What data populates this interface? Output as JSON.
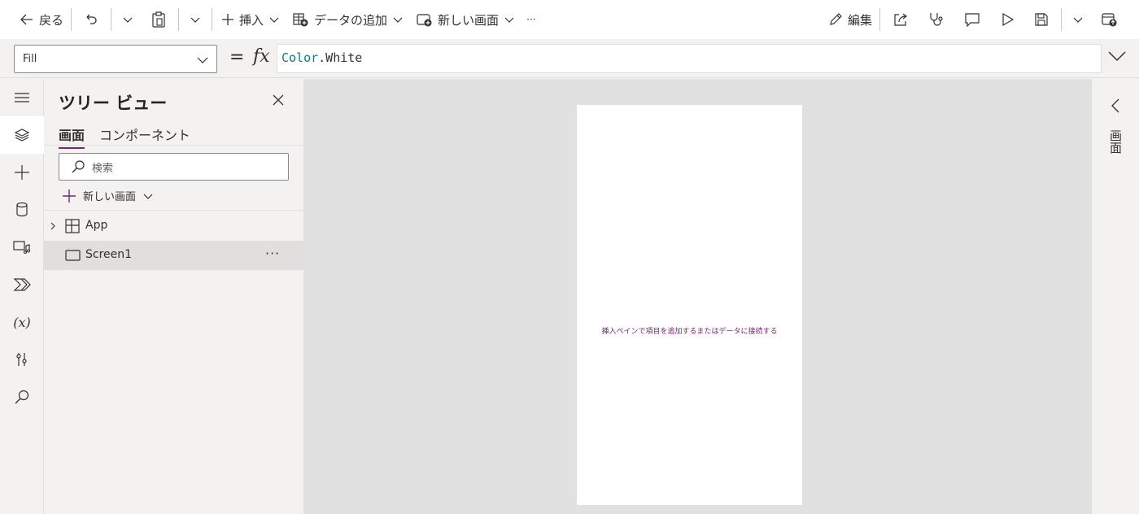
{
  "toolbar": {
    "back_label": "戻る",
    "insert_label": "挿入",
    "add_data_label": "データの追加",
    "new_screen_label": "新しい画面",
    "more_label": "···",
    "edit_label": "編集"
  },
  "formula_bar": {
    "property": "Fill",
    "equals": "=",
    "fx": "fx",
    "formula_object": "Color",
    "formula_rest": ".White"
  },
  "tree_view": {
    "title": "ツリー ビュー",
    "tabs": [
      {
        "label": "画面",
        "selected": true
      },
      {
        "label": "コンポーネント",
        "selected": false
      }
    ],
    "search_placeholder": "検索",
    "new_screen_label": "新しい画面",
    "nodes": [
      {
        "label": "App",
        "icon": "app-grid-icon"
      },
      {
        "label": "Screen1",
        "icon": "screen-icon",
        "selected": true,
        "more": "···"
      }
    ]
  },
  "left_rail": {
    "items": [
      "hamburger-icon",
      "layers-icon",
      "plus-icon",
      "database-icon",
      "media-icon",
      "power-automate-icon",
      "variables-icon",
      "tools-icon",
      "search-icon"
    ],
    "variables_glyph": "(x)"
  },
  "canvas": {
    "hint": "挿入ペインで項目を追加するまたはデータに接続する"
  },
  "right_pane": {
    "label": "画面"
  },
  "colors": {
    "accent": "#742774",
    "canvas_bg": "#e1e1e1",
    "pane_bg": "#f3f2f1"
  }
}
